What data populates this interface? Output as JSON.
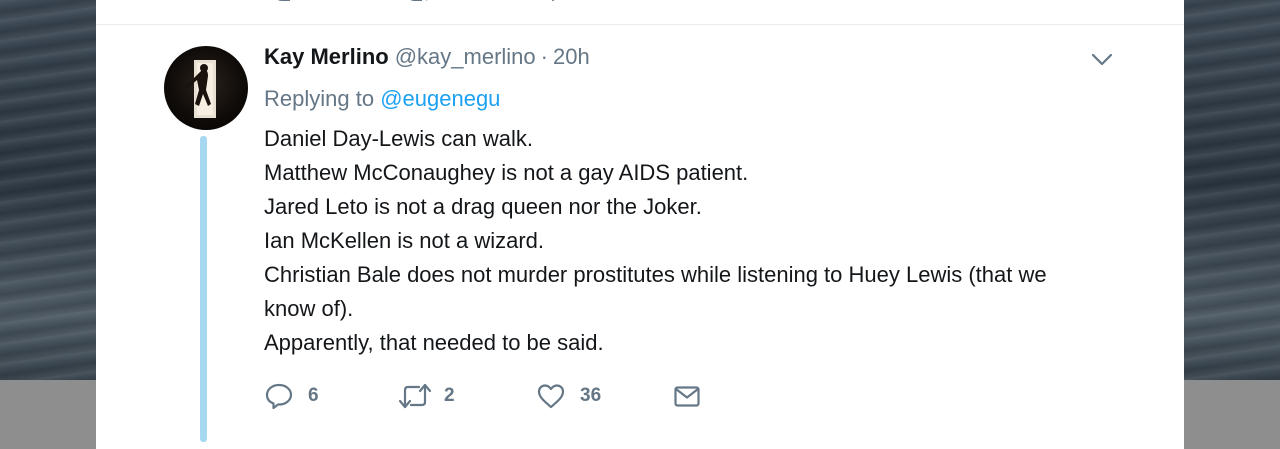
{
  "tweet": {
    "author_name": "Kay Merlino",
    "handle": "@kay_merlino",
    "separator": "·",
    "time": "20h",
    "replying_prefix": "Replying to",
    "replying_to": "@eugenegu",
    "lines": [
      "Daniel Day-Lewis can walk.",
      "Matthew McConaughey is not a gay AIDS patient.",
      "Jared Leto is not a drag queen nor the Joker.",
      "Ian McKellen is not a wizard.",
      "Christian Bale does not murder prostitutes while listening to Huey Lewis (that we know of).",
      "Apparently, that needed to be said."
    ],
    "actions": {
      "reply_count": "6",
      "retweet_count": "2",
      "like_count": "36"
    }
  },
  "icons": {
    "reply": "speech-bubble-icon",
    "retweet": "retweet-arrows-icon",
    "like": "heart-icon",
    "message": "envelope-icon",
    "menu": "chevron-down-icon"
  },
  "colors": {
    "text": "#14171a",
    "secondary": "#657786",
    "link": "#1da1f2",
    "thread_line": "#a6d8f2",
    "divider": "#e6ecf0"
  }
}
